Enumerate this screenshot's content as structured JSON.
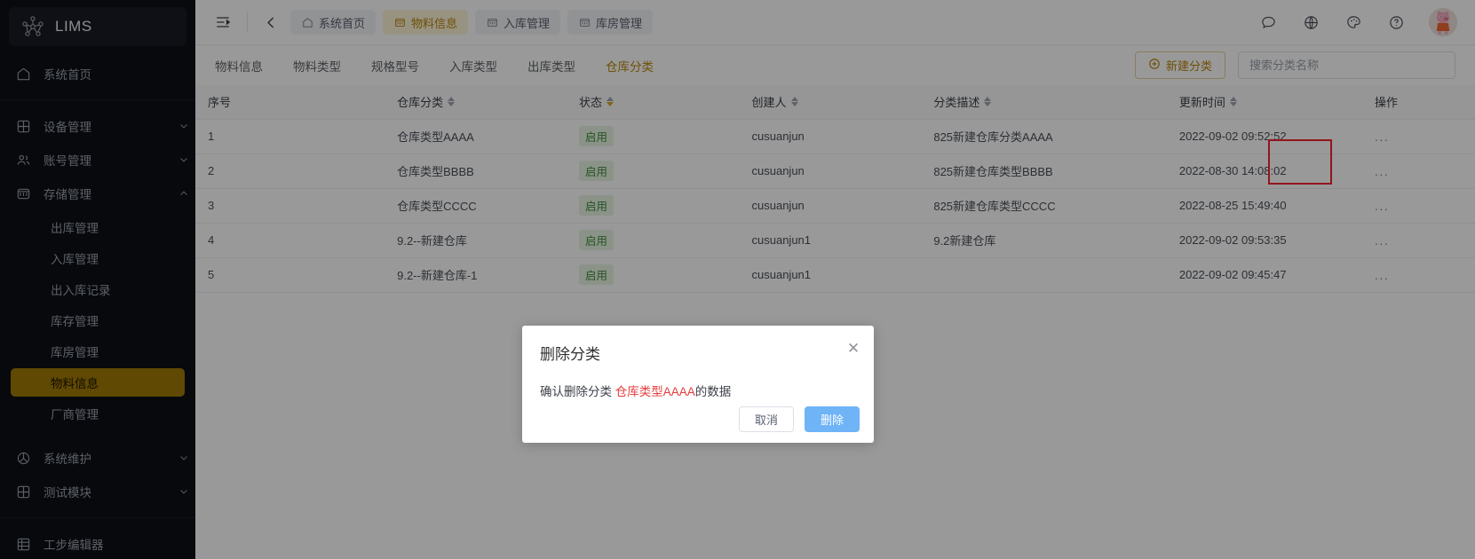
{
  "sidebar": {
    "brand": {
      "title": "LIMS",
      "logo_icon": "molecule-logo-icon"
    },
    "home": {
      "label": "系统首页",
      "icon": "home-icon"
    },
    "groups": [
      {
        "label": "设备管理",
        "icon": "grid-icon",
        "chevron": "chevron-down-icon"
      },
      {
        "label": "账号管理",
        "icon": "users-icon",
        "chevron": "chevron-down-icon"
      },
      {
        "label": "存储管理",
        "icon": "storage-icon",
        "chevron": "chevron-up-icon"
      }
    ],
    "storage_children": [
      {
        "label": "出库管理",
        "active": false
      },
      {
        "label": "入库管理",
        "active": false
      },
      {
        "label": "出入库记录",
        "active": false
      },
      {
        "label": "库存管理",
        "active": false
      },
      {
        "label": "库房管理",
        "active": false
      },
      {
        "label": "物料信息",
        "active": true
      },
      {
        "label": "厂商管理",
        "active": false
      }
    ],
    "groups_bottom": [
      {
        "label": "系统维护",
        "icon": "wrench-icon",
        "chevron": "chevron-down-icon"
      },
      {
        "label": "测试模块",
        "icon": "grid-icon",
        "chevron": "chevron-down-icon"
      }
    ],
    "footer_item": {
      "label": "工步编辑器",
      "icon": "table-icon"
    }
  },
  "topbar": {
    "collapse_icon": "collapse-menu-icon",
    "back_icon": "chevron-left-icon",
    "tabs": [
      {
        "label": "系统首页",
        "icon": "home-icon",
        "active": false
      },
      {
        "label": "物料信息",
        "icon": "storage-icon",
        "active": true
      },
      {
        "label": "入库管理",
        "icon": "storage-icon",
        "active": false
      },
      {
        "label": "库房管理",
        "icon": "storage-icon",
        "active": false
      }
    ],
    "right_icons": [
      {
        "name": "message-icon"
      },
      {
        "name": "globe-icon"
      },
      {
        "name": "palette-icon"
      },
      {
        "name": "help-icon"
      }
    ],
    "avatar": "user-avatar"
  },
  "subnav": {
    "tabs": [
      {
        "label": "物料信息",
        "active": false
      },
      {
        "label": "物料类型",
        "active": false
      },
      {
        "label": "规格型号",
        "active": false
      },
      {
        "label": "入库类型",
        "active": false
      },
      {
        "label": "出库类型",
        "active": false
      },
      {
        "label": "仓库分类",
        "active": true
      }
    ],
    "new_button": {
      "label": "新建分类",
      "icon": "plus-circle-icon"
    },
    "search": {
      "value": "",
      "placeholder": "搜索分类名称"
    }
  },
  "table": {
    "columns": [
      {
        "label": "序号",
        "sortable": false
      },
      {
        "label": "仓库分类",
        "sortable": true,
        "sort_state": "none"
      },
      {
        "label": "状态",
        "sortable": true,
        "sort_state": "desc"
      },
      {
        "label": "创建人",
        "sortable": true,
        "sort_state": "none"
      },
      {
        "label": "分类描述",
        "sortable": true,
        "sort_state": "none"
      },
      {
        "label": "更新时间",
        "sortable": true,
        "sort_state": "none"
      },
      {
        "label": "操作",
        "sortable": false
      }
    ],
    "rows": [
      {
        "idx": "1",
        "name": "仓库类型AAAA",
        "state": "启用",
        "user": "cusuanjun",
        "desc": "825新建仓库分类AAAA",
        "time": "2022-09-02 09:52:52",
        "action": "..."
      },
      {
        "idx": "2",
        "name": "仓库类型BBBB",
        "state": "启用",
        "user": "cusuanjun",
        "desc": "825新建仓库类型BBBB",
        "time": "2022-08-30 14:08:02",
        "action": "..."
      },
      {
        "idx": "3",
        "name": "仓库类型CCCC",
        "state": "启用",
        "user": "cusuanjun",
        "desc": "825新建仓库类型CCCC",
        "time": "2022-08-25 15:49:40",
        "action": "..."
      },
      {
        "idx": "4",
        "name": "9.2--新建仓库",
        "state": "启用",
        "user": "cusuanjun1",
        "desc": "9.2新建仓库",
        "time": "2022-09-02 09:53:35",
        "action": "..."
      },
      {
        "idx": "5",
        "name": "9.2--新建仓库-1",
        "state": "启用",
        "user": "cusuanjun1",
        "desc": "",
        "time": "2022-09-02 09:45:47",
        "action": "..."
      }
    ]
  },
  "modal": {
    "title": "删除分类",
    "close_icon": "close-icon",
    "message_prefix": "确认删除分类 ",
    "message_target": "仓库类型AAAA",
    "message_suffix": "的数据",
    "cancel_label": "取消",
    "confirm_label": "删除"
  },
  "colors": {
    "sidebar_bg": "#0d1017",
    "accent_gold": "#b8860b",
    "active_item_bg": "#a07a06",
    "status_green": "#3f8c3f",
    "danger_red": "#e43b3b",
    "primary_blue": "#6eb4f7",
    "annotation_red": "#f5222d"
  }
}
